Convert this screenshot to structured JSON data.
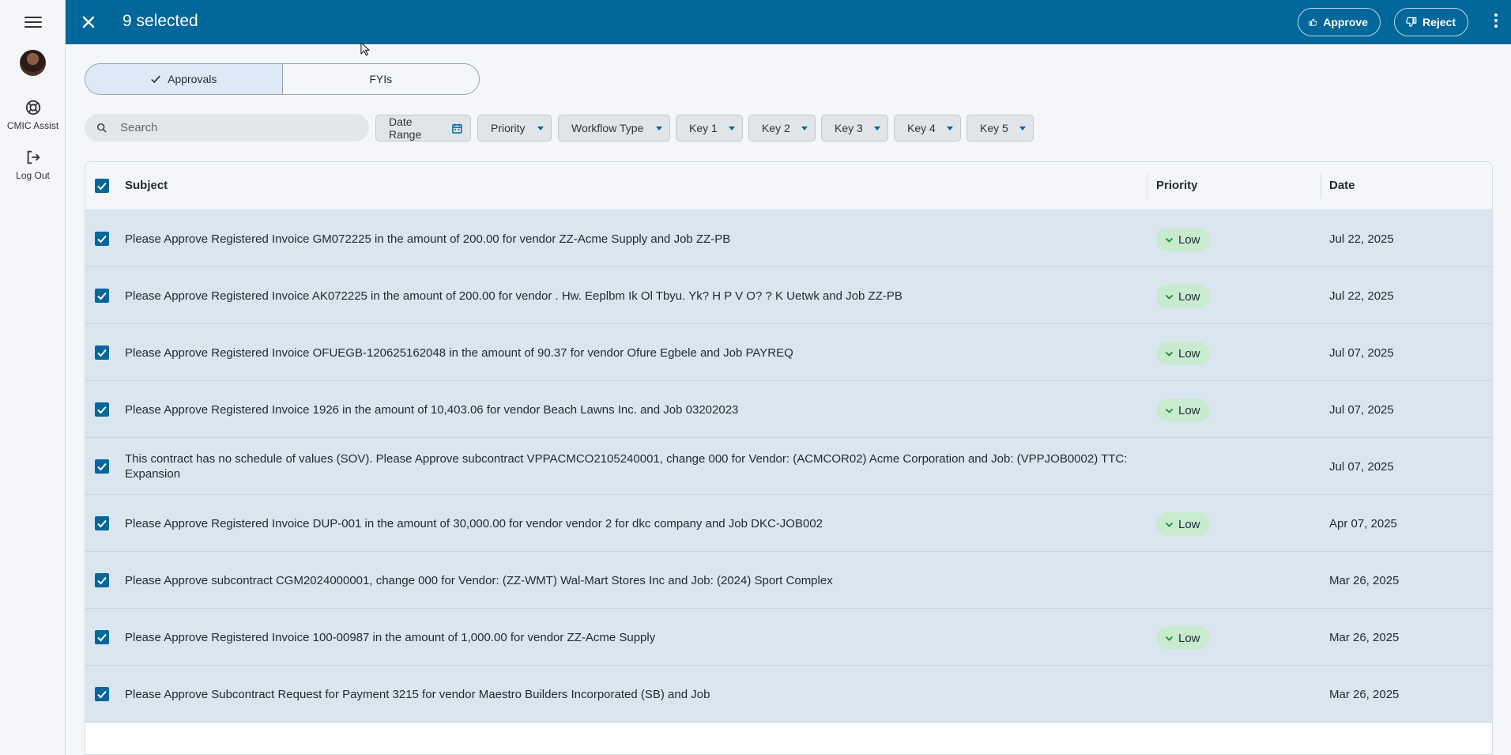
{
  "rail": {
    "assist_label": "CMIC Assist",
    "logout_label": "Log Out"
  },
  "topbar": {
    "title": "9 selected",
    "approve_label": "Approve",
    "reject_label": "Reject"
  },
  "tabs": [
    {
      "label": "Approvals",
      "active": true
    },
    {
      "label": "FYIs",
      "active": false
    }
  ],
  "search": {
    "placeholder": "Search"
  },
  "filters": {
    "date_range": "Date Range",
    "priority": "Priority",
    "workflow_type": "Workflow Type",
    "key1": "Key 1",
    "key2": "Key 2",
    "key3": "Key 3",
    "key4": "Key 4",
    "key5": "Key 5"
  },
  "table": {
    "headers": {
      "subject": "Subject",
      "priority": "Priority",
      "date": "Date"
    },
    "rows": [
      {
        "subject": "Please Approve Registered Invoice GM072225 in the amount of 200.00 for vendor ZZ-Acme Supply and Job ZZ-PB",
        "priority": "Low",
        "date": "Jul 22, 2025"
      },
      {
        "subject": "Please Approve Registered Invoice AK072225 in the amount of 200.00 for vendor . Hw. Eeplbm Ik Ol Tbyu. Yk? H P V O? ? K Uetwk and Job ZZ-PB",
        "priority": "Low",
        "date": "Jul 22, 2025"
      },
      {
        "subject": "Please Approve Registered Invoice OFUEGB-120625162048 in the amount of 90.37 for vendor Ofure Egbele and Job PAYREQ",
        "priority": "Low",
        "date": "Jul 07, 2025"
      },
      {
        "subject": "Please Approve Registered Invoice 1926 in the amount of 10,403.06 for vendor Beach Lawns Inc. and Job 03202023",
        "priority": "Low",
        "date": "Jul 07, 2025"
      },
      {
        "subject": "This contract has no schedule of values (SOV). Please Approve subcontract VPPACMCO2105240001, change 000 for Vendor: (ACMCOR02) Acme Corporation and Job: (VPPJOB0002) TTC: Expansion",
        "priority": "",
        "date": "Jul 07, 2025"
      },
      {
        "subject": "Please Approve Registered Invoice DUP-001 in the amount of 30,000.00 for vendor vendor 2 for dkc company and Job DKC-JOB002",
        "priority": "Low",
        "date": "Apr 07, 2025"
      },
      {
        "subject": "Please Approve subcontract CGM2024000001, change 000 for Vendor: (ZZ-WMT) Wal-Mart Stores Inc and Job: (2024) Sport Complex",
        "priority": "",
        "date": "Mar 26, 2025"
      },
      {
        "subject": "Please Approve Registered Invoice 100-00987 in the amount of 1,000.00 for vendor ZZ-Acme Supply",
        "priority": "Low",
        "date": "Mar 26, 2025"
      },
      {
        "subject": "Please Approve Subcontract Request for Payment 3215 for vendor Maestro Builders Incorporated (SB) and Job",
        "priority": "",
        "date": "Mar 26, 2025"
      }
    ]
  },
  "colors": {
    "primary": "#02679a",
    "row_selected": "#d9e6ef",
    "badge_low": "#c8ebd0",
    "badge_icon": "#1e8a3a"
  },
  "icons": {
    "menu": "hamburger-icon",
    "assist": "lifebuoy-icon",
    "logout": "logout-icon",
    "close": "close-icon",
    "approve": "thumbs-up-icon",
    "reject": "thumbs-down-icon",
    "more": "more-vert-icon",
    "check": "check-icon",
    "search": "search-icon",
    "calendar": "calendar-icon",
    "priority_low": "chevron-down-icon"
  }
}
